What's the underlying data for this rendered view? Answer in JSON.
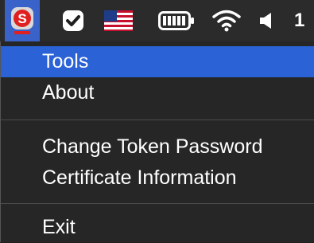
{
  "menubar": {
    "icons": [
      {
        "name": "safenet-token-icon",
        "letter": "S",
        "active": true
      },
      {
        "name": "checkmark-shield-icon"
      },
      {
        "name": "us-flag-icon"
      },
      {
        "name": "battery-icon"
      },
      {
        "name": "wifi-icon"
      },
      {
        "name": "speaker-icon"
      }
    ],
    "clock_fragment": "1"
  },
  "menu": {
    "items": [
      {
        "label": "Tools",
        "highlighted": true
      },
      {
        "label": "About"
      },
      {
        "label": "Change Token Password"
      },
      {
        "label": "Certificate Information"
      },
      {
        "label": "Exit"
      }
    ]
  },
  "colors": {
    "menu_bg": "#262626",
    "highlight": "#2b63d6",
    "menubar_bg": "#2b2b2b"
  }
}
